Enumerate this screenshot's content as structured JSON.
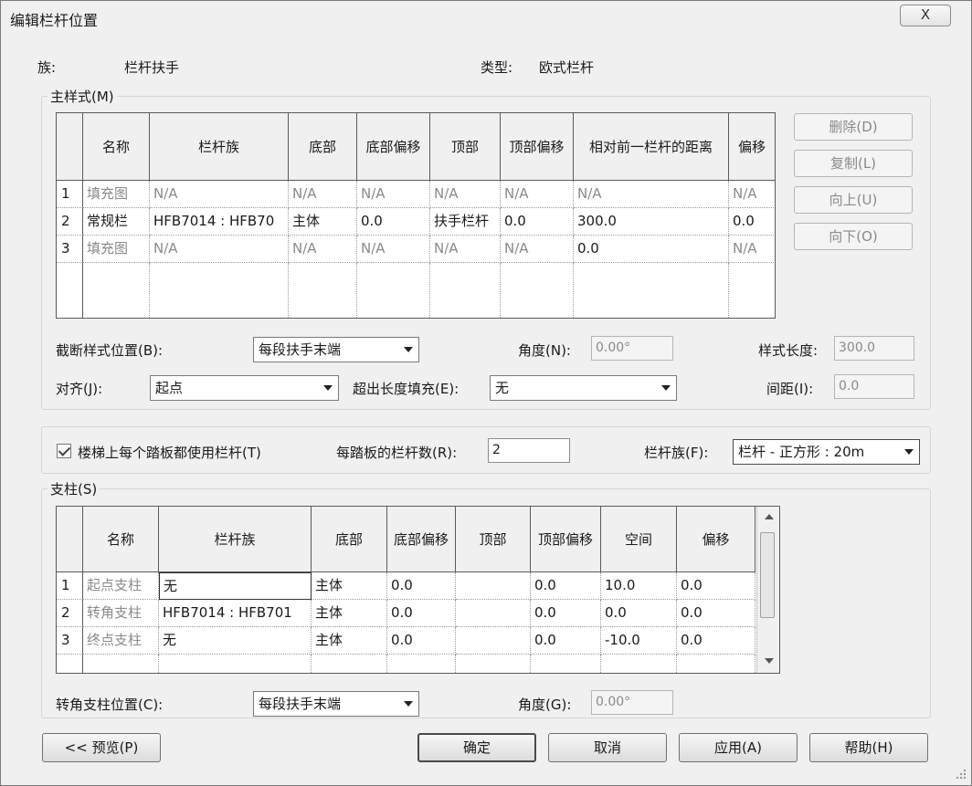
{
  "window": {
    "title": "编辑栏杆位置",
    "close_glyph": "X"
  },
  "header": {
    "family_label": "族:",
    "family_value": "栏杆扶手",
    "type_label": "类型:",
    "type_value": "欧式栏杆"
  },
  "main_pattern": {
    "title": "主样式(M)",
    "columns": [
      "名称",
      "栏杆族",
      "底部",
      "底部偏移",
      "顶部",
      "顶部偏移",
      "相对前一栏杆的距离",
      "偏移"
    ],
    "rows": [
      {
        "num": "1",
        "cells": [
          "填充图",
          "N/A",
          "N/A",
          "N/A",
          "N/A",
          "N/A",
          "N/A",
          "N/A"
        ],
        "grayed": true
      },
      {
        "num": "2",
        "cells": [
          "常规栏",
          "HFB7014 : HFB70",
          "主体",
          "0.0",
          "扶手栏杆",
          "0.0",
          "300.0",
          "0.0"
        ],
        "grayed": false
      },
      {
        "num": "3",
        "cells": [
          "填充图",
          "N/A",
          "N/A",
          "N/A",
          "N/A",
          "N/A",
          "0.0",
          "N/A"
        ],
        "grayed": true
      }
    ],
    "buttons": {
      "delete": "删除(D)",
      "copy": "复制(L)",
      "up": "向上(U)",
      "down": "向下(O)"
    },
    "break_pattern_label": "截断样式位置(B):",
    "break_pattern_value": "每段扶手末端",
    "angle_label": "角度(N):",
    "angle_value": "0.00°",
    "pattern_length_label": "样式长度:",
    "pattern_length_value": "300.0",
    "align_label": "对齐(J):",
    "align_value": "起点",
    "excess_label": "超出长度填充(E):",
    "excess_value": "无",
    "spacing_label": "间距(I):",
    "spacing_value": "0.0"
  },
  "stair": {
    "checkbox_label": "楼梯上每个踏板都使用栏杆(T)",
    "checked": true,
    "per_tread_label": "每踏板的栏杆数(R):",
    "per_tread_value": "2",
    "baluster_family_label": "栏杆族(F):",
    "baluster_family_value": "栏杆 - 正方形 : 20m"
  },
  "posts": {
    "title": "支柱(S)",
    "columns": [
      "名称",
      "栏杆族",
      "底部",
      "底部偏移",
      "顶部",
      "顶部偏移",
      "空间",
      "偏移"
    ],
    "rows": [
      {
        "num": "1",
        "cells": [
          "起点支柱",
          "无",
          "主体",
          "0.0",
          "",
          "0.0",
          "10.0",
          "0.0"
        ]
      },
      {
        "num": "2",
        "cells": [
          "转角支柱",
          "HFB7014 : HFB701",
          "主体",
          "0.0",
          "",
          "0.0",
          "0.0",
          "0.0"
        ]
      },
      {
        "num": "3",
        "cells": [
          "终点支柱",
          "无",
          "主体",
          "0.0",
          "",
          "0.0",
          "-10.0",
          "0.0"
        ]
      }
    ],
    "corner_label": "转角支柱位置(C):",
    "corner_value": "每段扶手末端",
    "angle_label": "角度(G):",
    "angle_value": "0.00°"
  },
  "footer": {
    "preview": "<< 预览(P)",
    "ok": "确定",
    "cancel": "取消",
    "apply": "应用(A)",
    "help": "帮助(H)"
  }
}
